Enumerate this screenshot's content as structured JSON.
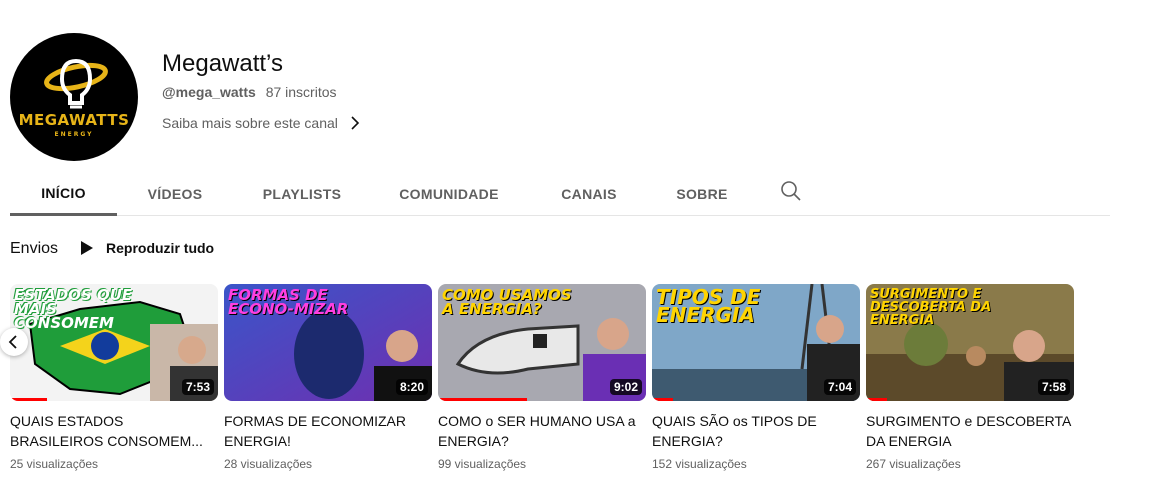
{
  "channel": {
    "name": "Megawatt’s",
    "handle": "@mega_watts",
    "subscribers": "87 inscritos",
    "about_link": "Saiba mais sobre este canal",
    "avatar_brand": "MEGAWATTS",
    "avatar_brand_sub": "ENERGY"
  },
  "tabs": [
    {
      "label": "INÍCIO",
      "active": true
    },
    {
      "label": "VÍDEOS"
    },
    {
      "label": "PLAYLISTS"
    },
    {
      "label": "COMUNIDADE"
    },
    {
      "label": "CANAIS"
    },
    {
      "label": "SOBRE"
    }
  ],
  "search_icon": "search-icon",
  "section": {
    "title": "Envios",
    "play_all": "Reproduzir tudo"
  },
  "videos": [
    {
      "thumb_text": "ESTADOS QUE MAIS CONSOMEM",
      "duration": "7:53",
      "title": "QUAIS ESTADOS BRASILEIROS CONSOMEM...",
      "views": "25 visualizações",
      "progress": 0.18
    },
    {
      "thumb_text": "FORMAS DE ECONO-MIZAR",
      "duration": "8:20",
      "title": "FORMAS DE ECONOMIZAR ENERGIA!",
      "views": "28 visualizações",
      "progress": 0
    },
    {
      "thumb_text": "COMO USAMOS A ENERGIA?",
      "duration": "9:02",
      "title": "COMO o SER HUMANO USA a ENERGIA?",
      "views": "99 visualizações",
      "progress": 0.43
    },
    {
      "thumb_text": "TIPOS DE ENERGIA",
      "duration": "7:04",
      "title": "QUAIS SÃO os TIPOS DE ENERGIA?",
      "views": "152 visualizações",
      "progress": 0.1
    },
    {
      "thumb_text": "SURGIMENTO E DESCOBERTA DA ENERGIA",
      "duration": "7:58",
      "title": "SURGIMENTO e DESCOBERTA DA ENERGIA",
      "views": "267 visualizações",
      "progress": 0.1
    }
  ],
  "colors": {
    "accent_red": "#ff0000",
    "brand_yellow": "#e7b418",
    "text_secondary": "#606060"
  }
}
